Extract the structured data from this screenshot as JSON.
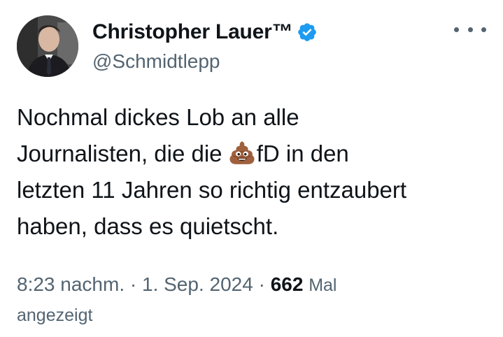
{
  "author": {
    "name": "Christopher Lauer™",
    "handle": "@Schmidtlepp",
    "verified_color": "#1d9bf0"
  },
  "tweet": {
    "line1": "Nochmal dickes Lob an alle",
    "line2_before": "Journalisten, die die ",
    "line2_emoji": "pile-of-poo-emoji",
    "line2_after": "fD in den",
    "line3": "letzten 11 Jahren so richtig entzaubert",
    "line4": "haben, dass es quietscht."
  },
  "meta": {
    "time": "8:23 nachm.",
    "separator": " · ",
    "date": "1. Sep. 2024",
    "views_count": "662",
    "views_label_1": "Mal",
    "views_label_2": "angezeigt"
  },
  "icons": {
    "more": "more-horizontal-icon",
    "verified": "verified-badge-icon"
  }
}
